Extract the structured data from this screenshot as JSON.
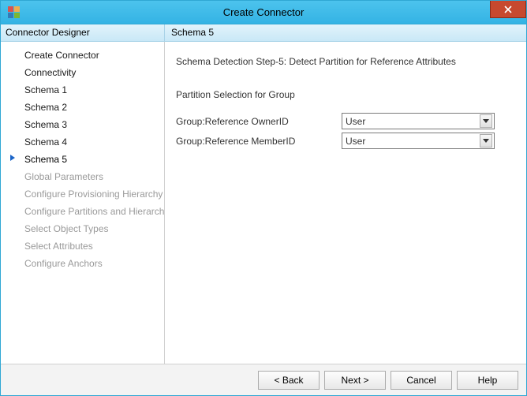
{
  "window": {
    "title": "Create Connector"
  },
  "subheader": {
    "left": "Connector Designer",
    "right": "Schema 5"
  },
  "sidebar": {
    "items": [
      {
        "label": "Create Connector",
        "state": "enabled"
      },
      {
        "label": "Connectivity",
        "state": "enabled"
      },
      {
        "label": "Schema 1",
        "state": "enabled"
      },
      {
        "label": "Schema 2",
        "state": "enabled"
      },
      {
        "label": "Schema 3",
        "state": "enabled"
      },
      {
        "label": "Schema 4",
        "state": "enabled"
      },
      {
        "label": "Schema 5",
        "state": "active"
      },
      {
        "label": "Global Parameters",
        "state": "disabled"
      },
      {
        "label": "Configure Provisioning Hierarchy",
        "state": "disabled"
      },
      {
        "label": "Configure Partitions and Hierarchies",
        "state": "disabled"
      },
      {
        "label": "Select Object Types",
        "state": "disabled"
      },
      {
        "label": "Select Attributes",
        "state": "disabled"
      },
      {
        "label": "Configure Anchors",
        "state": "disabled"
      }
    ]
  },
  "content": {
    "step_description": "Schema Detection Step-5: Detect Partition for Reference Attributes",
    "section_title": "Partition Selection for Group",
    "fields": [
      {
        "label": "Group:Reference OwnerID",
        "value": "User"
      },
      {
        "label": "Group:Reference MemberID",
        "value": "User"
      }
    ]
  },
  "footer": {
    "back": "<  Back",
    "next": "Next  >",
    "cancel": "Cancel",
    "help": "Help"
  }
}
